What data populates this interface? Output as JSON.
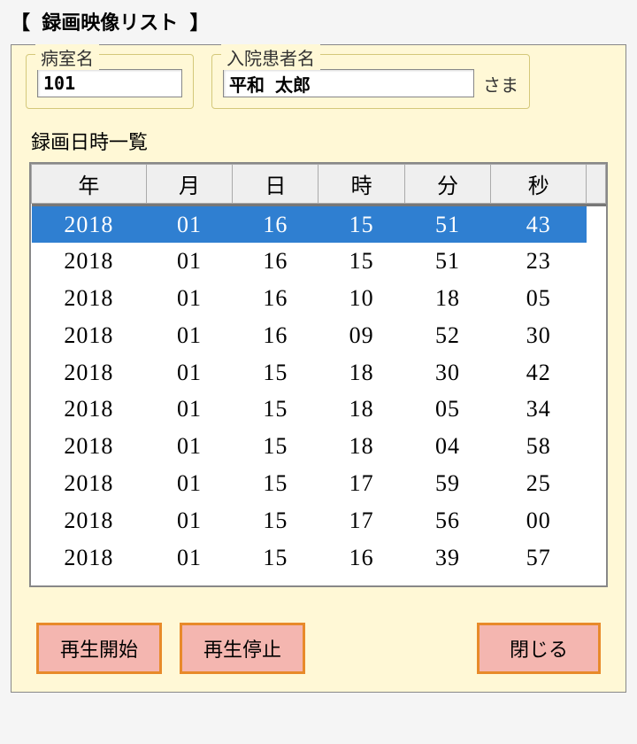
{
  "title": "【 録画映像リスト 】",
  "room": {
    "label": "病室名",
    "value": "101"
  },
  "patient": {
    "label": "入院患者名",
    "value": "平和 太郎",
    "suffix": "さま"
  },
  "listLabel": "録画日時一覧",
  "columns": {
    "year": "年",
    "month": "月",
    "day": "日",
    "hour": "時",
    "minute": "分",
    "second": "秒"
  },
  "rows": [
    {
      "year": "2018",
      "month": "01",
      "day": "16",
      "hour": "15",
      "minute": "51",
      "second": "43",
      "selected": true
    },
    {
      "year": "2018",
      "month": "01",
      "day": "16",
      "hour": "15",
      "minute": "51",
      "second": "23"
    },
    {
      "year": "2018",
      "month": "01",
      "day": "16",
      "hour": "10",
      "minute": "18",
      "second": "05"
    },
    {
      "year": "2018",
      "month": "01",
      "day": "16",
      "hour": "09",
      "minute": "52",
      "second": "30"
    },
    {
      "year": "2018",
      "month": "01",
      "day": "15",
      "hour": "18",
      "minute": "30",
      "second": "42"
    },
    {
      "year": "2018",
      "month": "01",
      "day": "15",
      "hour": "18",
      "minute": "05",
      "second": "34"
    },
    {
      "year": "2018",
      "month": "01",
      "day": "15",
      "hour": "18",
      "minute": "04",
      "second": "58"
    },
    {
      "year": "2018",
      "month": "01",
      "day": "15",
      "hour": "17",
      "minute": "59",
      "second": "25"
    },
    {
      "year": "2018",
      "month": "01",
      "day": "15",
      "hour": "17",
      "minute": "56",
      "second": "00"
    },
    {
      "year": "2018",
      "month": "01",
      "day": "15",
      "hour": "16",
      "minute": "39",
      "second": "57"
    }
  ],
  "buttons": {
    "play": "再生開始",
    "stop": "再生停止",
    "close": "閉じる"
  }
}
